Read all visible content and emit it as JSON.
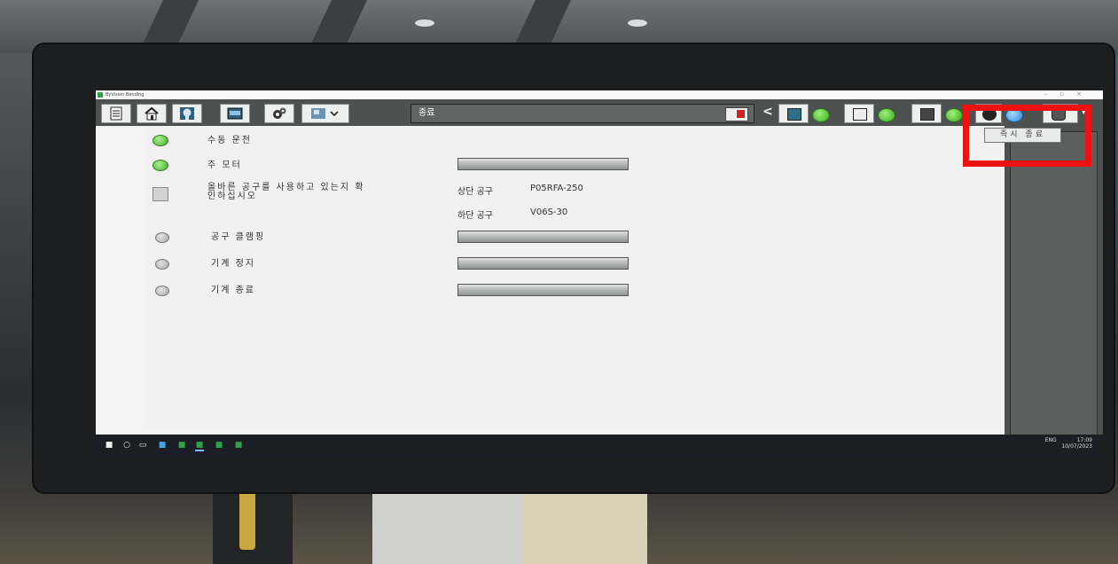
{
  "window": {
    "title": "ByVision Bending"
  },
  "toolbar": {
    "buttons": [
      {
        "icon": "clipboard-icon"
      },
      {
        "icon": "home-icon"
      },
      {
        "icon": "head-icon"
      },
      {
        "icon": "screen-icon"
      },
      {
        "icon": "gears-icon"
      },
      {
        "icon": "windows-icon"
      }
    ],
    "message": "종료"
  },
  "main": {
    "rows": [
      {
        "label": "수동 운전",
        "indicator": "green"
      },
      {
        "label": "주 모터",
        "indicator": "green"
      },
      {
        "label_line1": "올바른 공구를 사용하고 있는지 확",
        "label_line2": "인하십시오",
        "indicator": "square"
      },
      {
        "label": "공구 클램핑",
        "indicator": "gray"
      },
      {
        "label": "기계 정지",
        "indicator": "gray"
      },
      {
        "label": "기계 종료",
        "indicator": "gray"
      }
    ],
    "upper_tool_label": "상단 공구",
    "upper_tool_value": "P05RFA-250",
    "lower_tool_label": "하단 공구",
    "lower_tool_value": "V06S-30"
  },
  "side_panel": {
    "immediate_stop_label": "즉시 종료"
  },
  "taskbar": {
    "lang": "ENG",
    "time": "17:09",
    "date": "10/07/2023"
  },
  "colors": {
    "highlight": "#ee1111",
    "toolbar": "#4d5250",
    "status_green": "#43ab2a",
    "status_blue": "#2a86d8"
  }
}
